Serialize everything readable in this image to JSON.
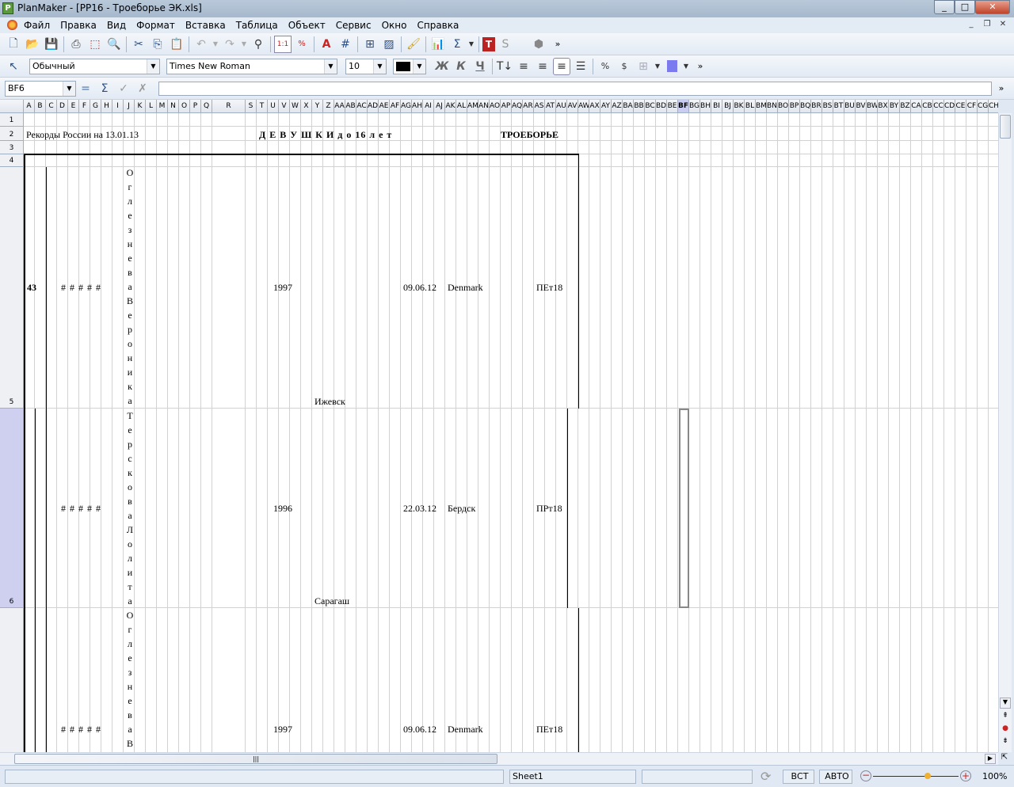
{
  "window": {
    "title": "PlanMaker - [PP16 - Троеборье ЭК.xls]",
    "app_icon": "P"
  },
  "menu": [
    "Файл",
    "Правка",
    "Вид",
    "Формат",
    "Вставка",
    "Таблица",
    "Объект",
    "Сервис",
    "Окно",
    "Справка"
  ],
  "format_bar": {
    "style": "Обычный",
    "font": "Times New Roman",
    "size": "10",
    "bold": "Ж",
    "italic": "К",
    "underline": "Ч",
    "fill_color": "#7b7bef",
    "text_color": "#000000"
  },
  "formula_bar": {
    "cell_ref": "BF6",
    "value": ""
  },
  "columns": [
    "A",
    "B",
    "C",
    "D",
    "E",
    "F",
    "G",
    "H",
    "I",
    "J",
    "K",
    "L",
    "M",
    "N",
    "O",
    "P",
    "Q",
    "R",
    "S",
    "T",
    "U",
    "V",
    "W",
    "X",
    "Y",
    "Z",
    "AA",
    "AB",
    "AC",
    "AD",
    "AE",
    "AF",
    "AG",
    "AH",
    "AI",
    "AJ",
    "AK",
    "AL",
    "AM",
    "AN",
    "AO",
    "AP",
    "AQ",
    "AR",
    "AS",
    "AT",
    "AU",
    "AV",
    "AW",
    "AX",
    "AY",
    "AZ",
    "BA",
    "BB",
    "BC",
    "BD",
    "BE",
    "BF",
    "BG",
    "BH",
    "BI",
    "BJ",
    "BK",
    "BL",
    "BM",
    "BN",
    "BO",
    "BP",
    "BQ",
    "BR",
    "BS",
    "BT",
    "BU",
    "BV",
    "BW",
    "BX",
    "BY",
    "BZ",
    "CA",
    "CB",
    "CC",
    "CD",
    "CE",
    "CF",
    "CG",
    "CH"
  ],
  "selected_column": "BF",
  "rows": [
    "1",
    "2",
    "3",
    "4",
    "5",
    "6"
  ],
  "selected_row": "6",
  "sheet": {
    "header_left": "Рекорды России на 13.01.13",
    "header_center": "Д Е В У Ш К И   д о   16  л е т",
    "header_right": "ТРОЕБОРЬЕ",
    "records": [
      {
        "number": "43",
        "hashes": [
          "#",
          "#",
          "#",
          "#",
          "#"
        ],
        "name": "ОглезневаВероника",
        "year": "1997",
        "city": "Ижевск",
        "date": "09.06.12",
        "place": "Denmark",
        "code": "ПЕт18"
      },
      {
        "number": "",
        "hashes": [
          "#",
          "#",
          "#",
          "#",
          "#"
        ],
        "name": "ТерсковаЛолита",
        "year": "1996",
        "city": "Сарагаш",
        "date": "22.03.12",
        "place": "Бердск",
        "code": "ПРт18"
      },
      {
        "number": "",
        "hashes": [
          "#",
          "#",
          "#",
          "#",
          "#"
        ],
        "name": "ОглезневаВ",
        "year": "1997",
        "city": "",
        "date": "09.06.12",
        "place": "Denmark",
        "code": "ПЕт18"
      }
    ]
  },
  "status": {
    "sheet_name": "Sheet1",
    "insert_mode": "ВСТ",
    "calc_mode": "АВТО",
    "zoom": "100%",
    "zoom_level_percent": 100
  }
}
